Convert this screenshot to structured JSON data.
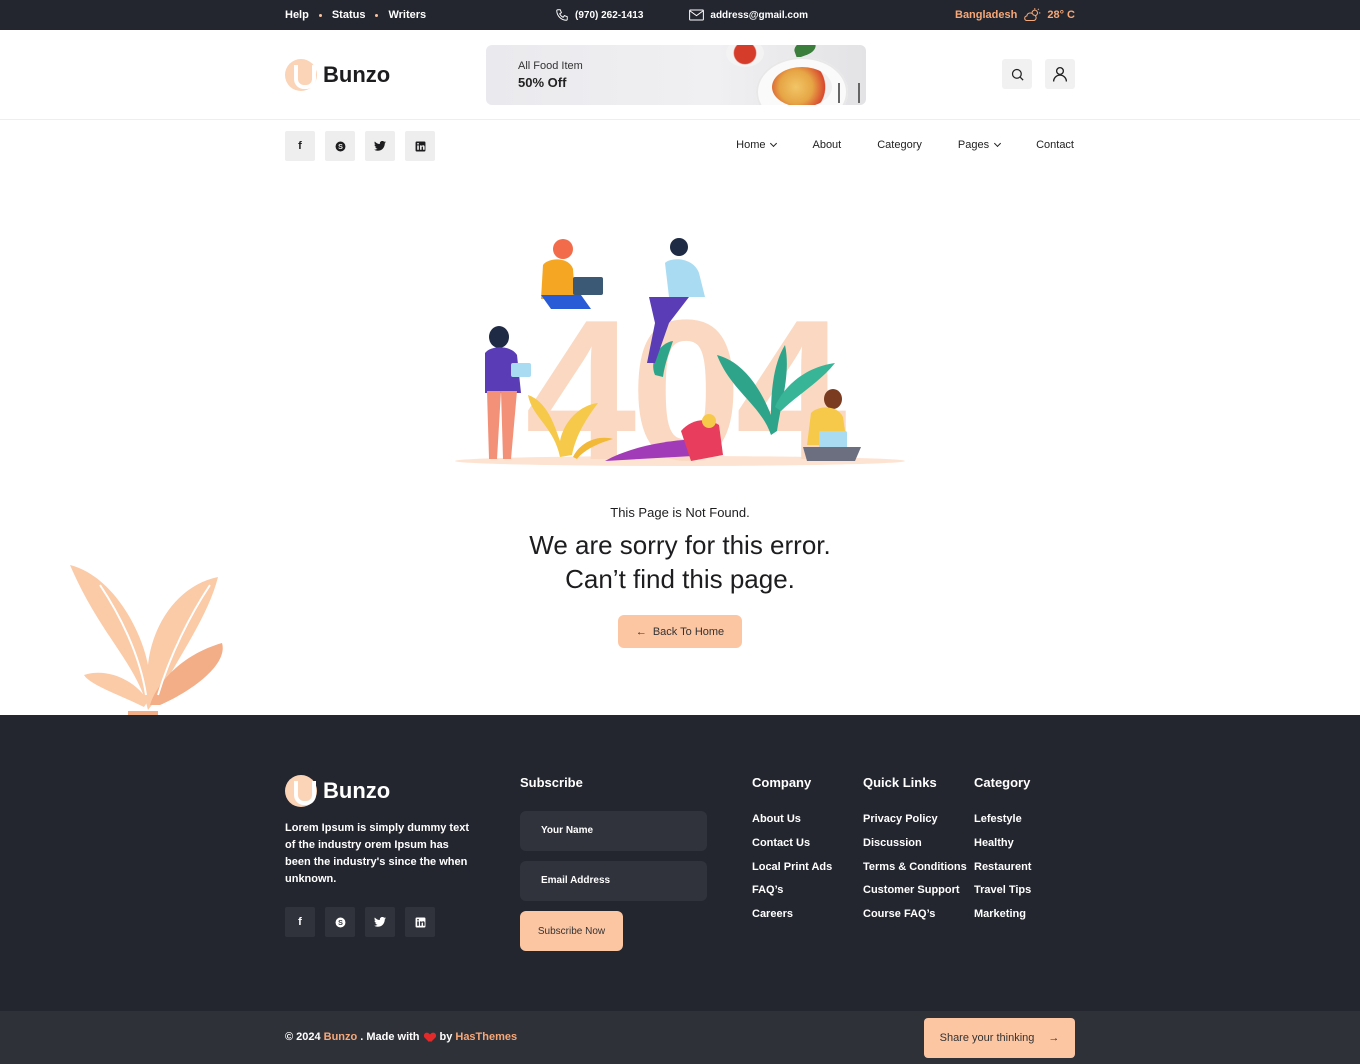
{
  "topbar": {
    "links": [
      "Help",
      "Status",
      "Writers"
    ],
    "phone": "(970) 262-1413",
    "email": "address@gmail.com",
    "location": "Bangladesh",
    "temperature": "28° C"
  },
  "header": {
    "logo_text": "Bunzo",
    "banner_line1": "All Food Item",
    "banner_line2": "50% Off"
  },
  "social_icons": [
    "facebook-icon",
    "skype-icon",
    "twitter-icon",
    "linkedin-icon"
  ],
  "nav": {
    "items": [
      {
        "label": "Home",
        "dropdown": true
      },
      {
        "label": "About",
        "dropdown": false
      },
      {
        "label": "Category",
        "dropdown": false
      },
      {
        "label": "Pages",
        "dropdown": true
      },
      {
        "label": "Contact",
        "dropdown": false
      }
    ]
  },
  "error": {
    "code_art": "404",
    "subtitle": "This Page is Not Found.",
    "title_line1": "We are sorry for this error.",
    "title_line2": "Can’t find this page.",
    "button": "Back To Home"
  },
  "footer": {
    "logo_text": "Bunzo",
    "description": "Lorem Ipsum is simply dummy text of the industry orem Ipsum has been the industry's since the when unknown.",
    "subscribe": {
      "heading": "Subscribe",
      "name_placeholder": "Your Name",
      "email_placeholder": "Email Address",
      "button": "Subscribe Now"
    },
    "company": {
      "heading": "Company",
      "links": [
        "About Us",
        "Contact Us",
        "Local Print Ads",
        "FAQ’s",
        "Careers"
      ]
    },
    "quick_links": {
      "heading": "Quick Links",
      "links": [
        "Privacy Policy",
        "Discussion",
        "Terms & Conditions",
        "Customer Support",
        "Course FAQ’s"
      ]
    },
    "category": {
      "heading": "Category",
      "links": [
        "Lefestyle",
        "Healthy",
        "Restaurent",
        "Travel Tips",
        "Marketing"
      ]
    }
  },
  "bottom": {
    "copyright": "© 2024",
    "brand": "Bunzo",
    "made_with": ". Made with",
    "by": "by",
    "author": "HasThemes",
    "share_button": "Share your thinking"
  },
  "colors": {
    "dark": "#23262f",
    "accent": "#fcc6a3",
    "accent_text": "#f7a878"
  }
}
